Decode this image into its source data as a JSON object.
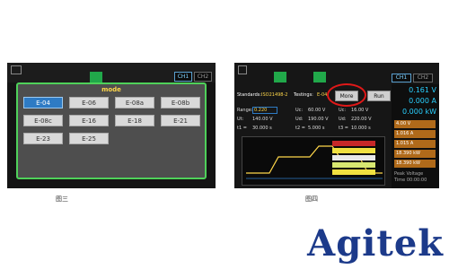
{
  "screen1": {
    "channels": [
      "CH1",
      "CH2"
    ],
    "dialog_title": "mode",
    "options": [
      "E-04",
      "E-06",
      "E-08a",
      "E-08b",
      "E-08c",
      "E-16",
      "E-18",
      "E-21",
      "E-23",
      "E-25"
    ],
    "selected": "E-04",
    "caption": "图三"
  },
  "screen2": {
    "standards_label": "Standards:",
    "standards_value": "ISO21498-2",
    "testings_label": "Testings:",
    "testings_value": "E-04",
    "more_button": "More",
    "run_button": "Run",
    "ranges_label": "Range:",
    "ranges_value": "0.220",
    "row1": [
      "Uc:",
      "60.00 V",
      "Uc:",
      "16.00 V"
    ],
    "row2": [
      "Ut:",
      "140.00 V",
      "Ud:",
      "190.00 V",
      "Ud:",
      "220.00 V"
    ],
    "row3": [
      "t1 =",
      "30.000 s",
      "t2 =",
      "5.000 s",
      "t3 =",
      "10.000 s"
    ],
    "channels": [
      "CH1",
      "CH2"
    ],
    "readouts": [
      "0.161 V",
      "0.000 A",
      "0.000 kW"
    ],
    "badges": [
      "4.00 V",
      "1.016 A",
      "1.015 A",
      "18.390 kW",
      "18.390 kW"
    ],
    "footer": [
      "Peak Voltage",
      "Time 00:00:00"
    ],
    "caption": "图四"
  },
  "brand": "Agitek"
}
